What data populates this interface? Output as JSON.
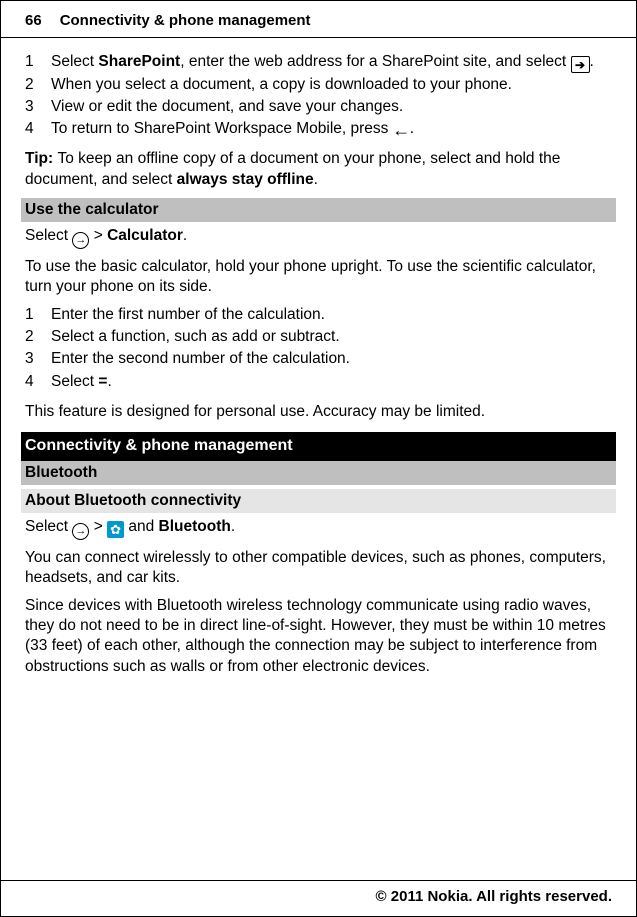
{
  "header": {
    "page_number": "66",
    "title": "Connectivity & phone management"
  },
  "steps_sharepoint": [
    {
      "num": "1",
      "pre": "Select ",
      "bold": "SharePoint",
      "post": ", enter the web address for a SharePoint site, and select ",
      "has_icon_end": true
    },
    {
      "num": "2",
      "text": "When you select a document, a copy is downloaded to your phone."
    },
    {
      "num": "3",
      "text": "View or edit the document, and save your changes."
    },
    {
      "num": "4",
      "pre": "To return to SharePoint Workspace Mobile, press ",
      "has_back_icon": true
    }
  ],
  "tip": {
    "label": "Tip: ",
    "pre": "To keep an offline copy of a document on your phone, select and hold the document, and select ",
    "bold": "always stay offline",
    "post": "."
  },
  "calc_heading": "Use the calculator",
  "calc_select_pre": "Select ",
  "calc_select_mid": " > ",
  "calc_select_bold": "Calculator",
  "calc_select_post": ".",
  "calc_para": "To use the basic calculator, hold your phone upright. To use the scientific calculator, turn your phone on its side.",
  "steps_calc": [
    {
      "num": "1",
      "text": "Enter the first number of the calculation."
    },
    {
      "num": "2",
      "text": "Select a function, such as add or subtract."
    },
    {
      "num": "3",
      "text": "Enter the second number of the calculation."
    },
    {
      "num": "4",
      "pre": "Select ",
      "bold": "=",
      "post": "."
    }
  ],
  "calc_note": "This feature is designed for personal use. Accuracy may be limited.",
  "conn_heading": "Connectivity & phone management",
  "bt_heading": "Bluetooth",
  "bt_about_heading": "About Bluetooth connectivity",
  "bt_select_pre": "Select ",
  "bt_select_mid1": " > ",
  "bt_select_mid2": " and ",
  "bt_select_bold": "Bluetooth",
  "bt_select_post": ".",
  "bt_para1": "You can connect wirelessly to other compatible devices, such as phones, computers, headsets, and car kits.",
  "bt_para2": "Since devices with Bluetooth wireless technology communicate using radio waves, they do not need to be in direct line-of-sight. However, they must be within 10 metres (33 feet) of each other, although the connection may be subject to interference from obstructions such as walls or from other electronic devices.",
  "footer": "© 2011 Nokia. All rights reserved."
}
